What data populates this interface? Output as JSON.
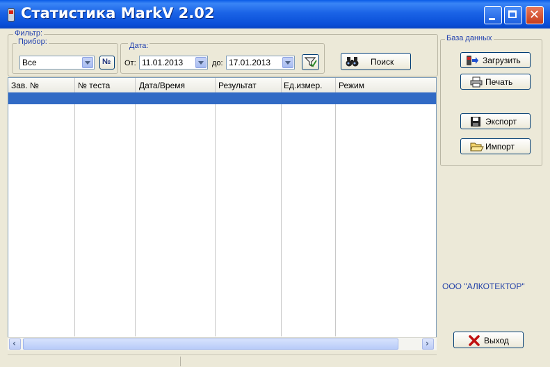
{
  "window": {
    "title": "Статистика MarkV 2.02"
  },
  "filter": {
    "group_label": "Фильтр:",
    "device": {
      "label": "Прибор:",
      "selected": "Все",
      "num_button_label": "№"
    },
    "date": {
      "label": "Дата:",
      "from_label": "От:",
      "from_value": "11.01.2013",
      "to_label": "до:",
      "to_value": "17.01.2013"
    },
    "search_button_label": "Поиск"
  },
  "database": {
    "group_label": "База данных",
    "load_label": "Загрузить",
    "print_label": "Печать",
    "export_label": "Экспорт",
    "import_label": "Импорт"
  },
  "table": {
    "columns": [
      "Зав. №",
      "№ теста",
      "Дата/Время",
      "Результат",
      "Ед.измер.",
      "Режим"
    ],
    "rows": []
  },
  "company": "ООО \"АЛКОТЕКТОР\"",
  "exit_label": "Выход",
  "colors": {
    "title_bar": "#0a4fd8",
    "selection": "#316ac5",
    "company_text": "#2442a8",
    "group_label": "#1f3fae",
    "window_bg": "#ece9d8"
  },
  "icons": {
    "app": "phone-icon",
    "number_filter": "number-sign-icon",
    "clear_filter": "funnel-check-icon",
    "search": "binoculars-icon",
    "load": "device-arrow-icon",
    "print": "printer-icon",
    "export": "floppy-disk-icon",
    "import": "open-folder-icon",
    "exit": "red-x-icon"
  }
}
